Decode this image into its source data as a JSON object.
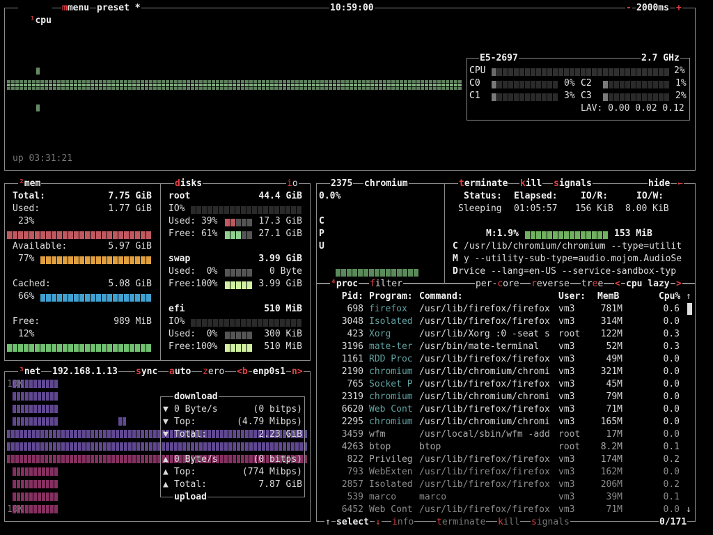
{
  "cpu_box": {
    "title_hotkey": "¹",
    "title": "cpu",
    "menu": "menu",
    "preset": "preset *",
    "clock": "10:59:00",
    "minus": "-",
    "interval": "2000ms",
    "plus": "+",
    "uptime": "up 03:31:21",
    "model": "E5-2697",
    "freq": "2.7 GHz",
    "cpu_label": "CPU",
    "cpu_pct": "2%",
    "cores": [
      {
        "name": "C0",
        "pct": "0%",
        "level": 0.05
      },
      {
        "name": "C1",
        "pct": "3%",
        "level": 0.08
      },
      {
        "name": "C2",
        "pct": "1%",
        "level": 0.04
      },
      {
        "name": "C3",
        "pct": "2%",
        "level": 0.06
      }
    ],
    "lav": "LAV: 0.00 0.02 0.12"
  },
  "mem_box": {
    "title_hotkey": "²",
    "title": "mem",
    "total_label": "Total:",
    "total": "7.75 GiB",
    "used_label": "Used:",
    "used": "1.77 GiB",
    "used_pct": "23%",
    "available_label": "Available:",
    "available": "5.97 GiB",
    "available_pct": "77%",
    "cached_label": "Cached:",
    "cached": "5.08 GiB",
    "cached_pct": "66%",
    "free_label": "Free:",
    "free": "989 MiB",
    "free_pct": "12%"
  },
  "disks_box": {
    "title": "disks",
    "io": "io",
    "root_label": "root",
    "root_size": "44.4 GiB",
    "root_io": "IO%",
    "root_used_label": "Used: 39%",
    "root_used": "17.3 GiB",
    "root_free_label": "Free: 61%",
    "root_free": "27.1 GiB",
    "swap_label": "swap",
    "swap_size": "3.99 GiB",
    "swap_used_label": "Used:  0%",
    "swap_used": "0 Byte",
    "swap_free_label": "Free:100%",
    "swap_free": "3.99 GiB",
    "efi_label": "efi",
    "efi_size": "510 MiB",
    "efi_io": "IO%",
    "efi_used_label": "Used:  0%",
    "efi_used": "300 KiB",
    "efi_free_label": "Free:100%",
    "efi_free": "510 MiB"
  },
  "net_box": {
    "title_hotkey": "³",
    "title": "net",
    "ip": "192.168.1.13",
    "sync": "sync",
    "auto": "auto",
    "zero": "zero",
    "prev": "<b",
    "iface": "enp0s1",
    "next": "n>",
    "scale_top": "10K",
    "scale_bottom": "10K",
    "download_title": "download",
    "upload_title": "upload",
    "dl_rate": "0 Byte/s",
    "dl_bits": "(0 bitps)",
    "dl_top_label": "Top:",
    "dl_top": "(4.79 Mibps)",
    "dl_total_label": "Total:",
    "dl_total": "2.23 GiB",
    "ul_rate": "0 Byte/s",
    "ul_bits": "(0 bitps)",
    "ul_top_label": "Top:",
    "ul_top": "(774 Mibps)",
    "ul_total_label": "Total:",
    "ul_total": "7.87 GiB"
  },
  "detail_box": {
    "pid": "2375",
    "name": "chromium",
    "cpu_pct": "0.0%",
    "cpu_vertical": [
      "C",
      "P",
      "U"
    ],
    "terminate": "terminate",
    "kill": "kill",
    "signals": "signals",
    "hide": "hide",
    "status_label": "Status:",
    "status": "Sleeping",
    "elapsed_label": "Elapsed:",
    "elapsed": "01:05:57",
    "ior_label": "IO/R:",
    "ior": "156 KiB",
    "iow_label": "IO/W:",
    "iow": "8.00 KiB",
    "mem_label": "M:1.9%",
    "mem_value": "153 MiB",
    "cmd_vertical": [
      "C",
      "M",
      "D"
    ],
    "cmd_lines": [
      "/usr/lib/chromium/chromium --type=utilit",
      "y --utility-sub-type=audio.mojom.AudioSe",
      "rvice --lang=en-US --service-sandbox-typ"
    ]
  },
  "proc_box": {
    "title_hotkey": "⁴",
    "title": "proc",
    "filter": "filter",
    "per_core": "per-core",
    "reverse": "reverse",
    "tree": "tree",
    "sort_prev": "<",
    "sort": "cpu lazy",
    "sort_next": ">",
    "headers": {
      "pid": "Pid:",
      "program": "Program:",
      "command": "Command:",
      "user": "User:",
      "memb": "MemB",
      "cpu": "Cpu%"
    },
    "rows": [
      {
        "pid": "698",
        "program": "firefox",
        "command": "/usr/lib/firefox/firefox",
        "user": "vm3",
        "memb": "781M",
        "cpu": "0.6",
        "level": 0.6
      },
      {
        "pid": "3048",
        "program": "Isolated",
        "command": "/usr/lib/firefox/firefox",
        "user": "vm3",
        "memb": "314M",
        "cpu": "0.0",
        "level": 0.1
      },
      {
        "pid": "423",
        "program": "Xorg",
        "command": "/usr/lib/Xorg :0 -seat s",
        "user": "root",
        "memb": "122M",
        "cpu": "0.3",
        "level": 0.5
      },
      {
        "pid": "3196",
        "program": "mate-ter",
        "command": "/usr/bin/mate-terminal",
        "user": "vm3",
        "memb": "52M",
        "cpu": "0.3",
        "level": 0.5
      },
      {
        "pid": "1161",
        "program": "RDD Proc",
        "command": "/usr/lib/firefox/firefox",
        "user": "vm3",
        "memb": "49M",
        "cpu": "0.0",
        "level": 0.0
      },
      {
        "pid": "2190",
        "program": "chromium",
        "command": "/usr/lib/chromium/chromi",
        "user": "vm3",
        "memb": "321M",
        "cpu": "0.0",
        "level": 0.1
      },
      {
        "pid": "765",
        "program": "Socket P",
        "command": "/usr/lib/firefox/firefox",
        "user": "vm3",
        "memb": "45M",
        "cpu": "0.0",
        "level": 0.0
      },
      {
        "pid": "2319",
        "program": "chromium",
        "command": "/usr/lib/chromium/chromi",
        "user": "vm3",
        "memb": "79M",
        "cpu": "0.0",
        "level": 0.0
      },
      {
        "pid": "6620",
        "program": "Web Cont",
        "command": "/usr/lib/firefox/firefox",
        "user": "vm3",
        "memb": "71M",
        "cpu": "0.0",
        "level": 0.0
      },
      {
        "pid": "2295",
        "program": "chromium",
        "command": "/usr/lib/chromium/chromi",
        "user": "vm3",
        "memb": "165M",
        "cpu": "0.0",
        "level": 0.0
      },
      {
        "pid": "3459",
        "program": "wfm",
        "command": "/usr/local/sbin/wfm -add",
        "user": "root",
        "memb": "17M",
        "cpu": "0.0",
        "level": 0.0
      },
      {
        "pid": "4263",
        "program": "btop",
        "command": "btop",
        "user": "root",
        "memb": "8.2M",
        "cpu": "0.1",
        "level": 0.1
      },
      {
        "pid": "822",
        "program": "Privileg",
        "command": "/usr/lib/firefox/firefox",
        "user": "vm3",
        "memb": "174M",
        "cpu": "0.2",
        "level": 0.2
      },
      {
        "pid": "793",
        "program": "WebExten",
        "command": "/usr/lib/firefox/firefox",
        "user": "vm3",
        "memb": "162M",
        "cpu": "0.0",
        "level": 0.0
      },
      {
        "pid": "2857",
        "program": "Isolated",
        "command": "/usr/lib/firefox/firefox",
        "user": "vm3",
        "memb": "206M",
        "cpu": "0.2",
        "level": 0.2
      },
      {
        "pid": "539",
        "program": "marco",
        "command": "marco",
        "user": "vm3",
        "memb": "39M",
        "cpu": "0.1",
        "level": 0.1
      },
      {
        "pid": "6452",
        "program": "Web Cont",
        "command": "/usr/lib/firefox/firefox",
        "user": "vm3",
        "memb": "71M",
        "cpu": "0.0",
        "level": 0.0
      }
    ],
    "footer": {
      "up_arrow": "↑",
      "select": "select",
      "down_arrow": "↓",
      "info": "info",
      "terminate": "terminate",
      "kill": "kill",
      "signals": "signals",
      "count": "0/171"
    }
  },
  "colors": {
    "cpu_graph": "#8fc38f",
    "mem_used": "#c05860",
    "mem_available": "#e0a040",
    "mem_cached": "#40a0d0",
    "mem_free": "#70c070",
    "net_download": "#8060c0",
    "net_upload": "#b04080",
    "hotkey": "#e04040"
  }
}
